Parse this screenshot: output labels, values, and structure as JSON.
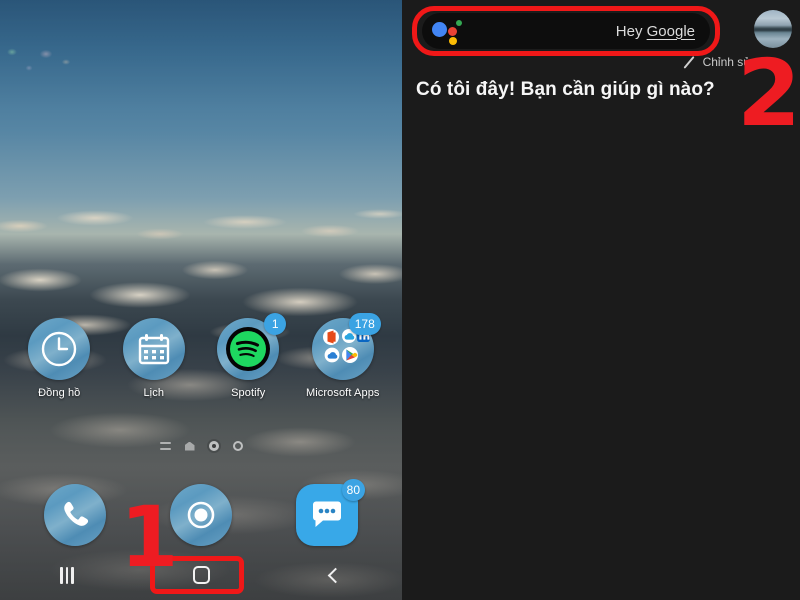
{
  "phone_home": {
    "name": "android-home-screen",
    "wallpaper_description": "aerial photo of clouds and blue sky",
    "apps": [
      {
        "label": "Đồng hồ",
        "icon": "clock-icon",
        "badge": null
      },
      {
        "label": "Lịch",
        "icon": "calendar-icon",
        "badge": null
      },
      {
        "label": "Spotify",
        "icon": "spotify-icon",
        "badge": "1"
      },
      {
        "label": "Microsoft Apps",
        "icon": "app-folder-icon",
        "badge": "178"
      }
    ],
    "dock": [
      {
        "label": "",
        "icon": "phone-icon",
        "badge": null
      },
      {
        "label": "",
        "icon": "camera-icon",
        "badge": null
      },
      {
        "label": "",
        "icon": "messages-icon",
        "badge": "80"
      }
    ],
    "page_indicator": {
      "items": [
        "feed-icon",
        "home-icon",
        "page-dot-active",
        "page-dot"
      ],
      "active_index": 2
    },
    "nav_bar": {
      "recents_label": "|||",
      "home_label": "O",
      "back_label": "<"
    }
  },
  "assistant": {
    "search_bar": {
      "logo": "google-assistant-icon",
      "hint_prefix": "Hey ",
      "hint_underlined": "Google"
    },
    "avatar": "user-avatar",
    "edit": {
      "icon": "pencil-icon",
      "label": "Chỉnh sửa"
    },
    "reply_text": "Có tôi đây! Bạn cần giúp gì nào?"
  },
  "annotations": {
    "step_1": "1",
    "step_2": "2",
    "highlight_color": "#f01818",
    "step_color": "#ee1c22"
  }
}
